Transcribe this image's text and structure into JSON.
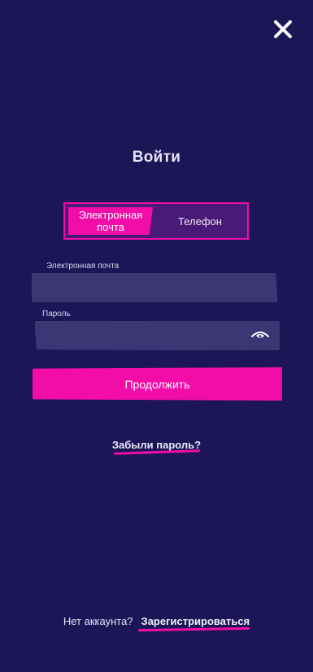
{
  "header": {
    "title": "Войти",
    "close_icon": "close-icon"
  },
  "tabs": {
    "email_label": "Электронная\nпочта",
    "phone_label": "Телефон",
    "active": "email"
  },
  "form": {
    "email_label": "Электронная почта",
    "email_value": "",
    "password_label": "Пароль",
    "password_value": "",
    "eye_icon": "eye-icon",
    "continue_label": "Продолжить"
  },
  "links": {
    "forgot_password": "Забыли пароль?"
  },
  "footer": {
    "no_account": "Нет аккаунта?",
    "register": "Зарегистрироваться"
  },
  "colors": {
    "background": "#1c1657",
    "accent": "#f20ca8",
    "input_bg": "#3b3775",
    "tab_bg": "#4a1a78"
  }
}
